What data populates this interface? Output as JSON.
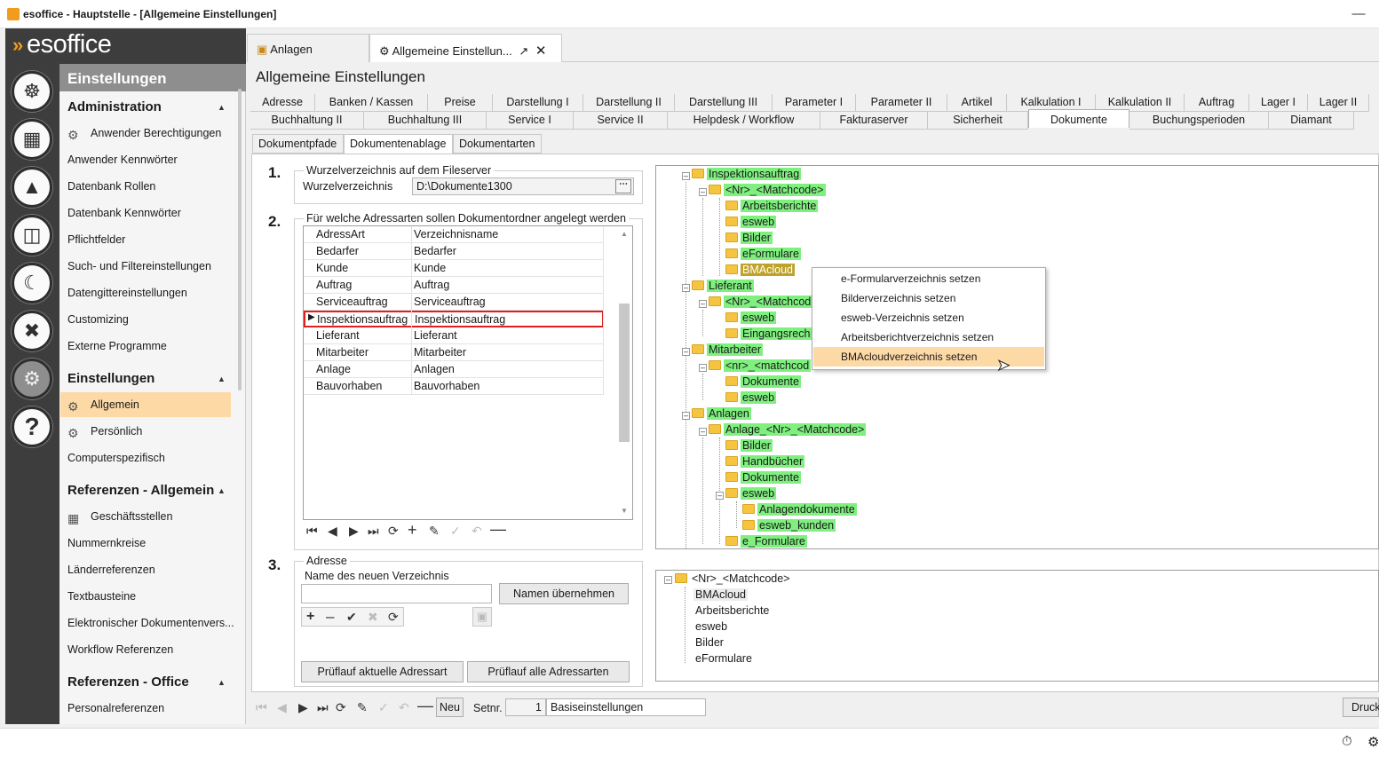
{
  "window": {
    "title": "esoffice - Hauptstelle - [Allgemeine Einstellungen]",
    "min_icon": "minimize-icon",
    "max_icon": "maximize-icon",
    "close_icon": "close-icon"
  },
  "brand": {
    "logo_text": "esoffice",
    "accent": "#f29b1d"
  },
  "doc_tabs": [
    {
      "label": "Anlagen",
      "icon": "factory-icon"
    },
    {
      "label": "Allgemeine Einstellun...",
      "icon": "gear-icon",
      "active": true
    }
  ],
  "sidebar": {
    "header": "Einstellungen",
    "groups": [
      {
        "title": "Administration",
        "items": [
          "Anwender Berechtigungen",
          "Anwender Kennwörter",
          "Datenbank Rollen",
          "Datenbank Kennwörter",
          "Pflichtfelder",
          "Such- und Filtereinstellungen",
          "Datengittereinstellungen",
          "Customizing",
          "Externe Programme"
        ]
      },
      {
        "title": "Einstellungen",
        "items": [
          "Allgemein",
          "Persönlich",
          "Computerspezifisch"
        ]
      },
      {
        "title": "Referenzen - Allgemein",
        "items": [
          "Geschäftsstellen",
          "Nummernkreise",
          "Länderreferenzen",
          "Textbausteine",
          "Elektronischer Dokumentenvers...",
          "Workflow Referenzen"
        ]
      },
      {
        "title": "Referenzen - Office",
        "items": [
          "Personalreferenzen"
        ]
      }
    ]
  },
  "page_title": "Allgemeine Einstellungen",
  "tabs_row1": [
    "Adresse",
    "Banken / Kassen",
    "Preise",
    "Darstellung I",
    "Darstellung II",
    "Darstellung III",
    "Parameter I",
    "Parameter II",
    "Artikel",
    "Kalkulation I",
    "Kalkulation II",
    "Auftrag",
    "Lager I",
    "Lager II"
  ],
  "tabs_row2": [
    "Buchhaltung II",
    "Buchhaltung III",
    "Service I",
    "Service II",
    "Helpdesk / Workflow",
    "Fakturaserver",
    "Sicherheit",
    "Dokumente",
    "Buchungsperioden",
    "Diamant"
  ],
  "active_tab": "Dokumente",
  "subtabs": [
    "Dokumentpfade",
    "Dokumentenablage",
    "Dokumentarten"
  ],
  "active_subtab": "Dokumentenablage",
  "step1": {
    "num": "1.",
    "legend": "Wurzelverzeichnis auf dem Fileserver",
    "label": "Wurzelverzeichnis",
    "value": "D:\\Dokumente1300",
    "browse": "..."
  },
  "step2": {
    "num": "2.",
    "legend": "Für welche Adressarten sollen Dokumentordner angelegt werden",
    "columns": [
      "AdressArt",
      "Verzeichnisname"
    ],
    "rows": [
      [
        "Bedarfer",
        "Bedarfer"
      ],
      [
        "Kunde",
        "Kunde"
      ],
      [
        "Auftrag",
        "Auftrag"
      ],
      [
        "Serviceauftrag",
        "Serviceauftrag"
      ],
      [
        "Inspektionsauftrag",
        "Inspektionsauftrag"
      ],
      [
        "Lieferant",
        "Lieferant"
      ],
      [
        "Mitarbeiter",
        "Mitarbeiter"
      ],
      [
        "Anlage",
        "Anlagen"
      ],
      [
        "Bauvorhaben",
        "Bauvorhaben"
      ]
    ],
    "selected_row": "Inspektionsauftrag"
  },
  "step3": {
    "num": "3.",
    "legend": "Adresse",
    "label": "Name des neuen Verzeichnis",
    "value": "",
    "accept_btn": "Namen übernehmen",
    "check_current_btn": "Prüflauf aktuelle Adressart",
    "check_all_btn": "Prüflauf alle Adressarten"
  },
  "tree": {
    "nodes": [
      "Inspektionsauftrag",
      "<Nr>_<Matchcode>",
      "Arbeitsberichte",
      "esweb",
      "Bilder",
      "eFormulare",
      "BMAcloud",
      "Lieferant",
      "<Nr>_<Matchcod",
      "esweb",
      "Eingangsrech",
      "Mitarbeiter",
      "<nr>_<matchcod",
      "Dokumente",
      "esweb",
      "Anlagen",
      "Anlage_<Nr>_<Matchcode>",
      "Bilder",
      "Handbücher",
      "Dokumente",
      "esweb",
      "Anlagendokumente",
      "esweb_kunden",
      "e_Formulare"
    ]
  },
  "context_menu": [
    "e-Formularverzeichnis setzen",
    "Bilderverzeichnis setzen",
    "esweb-Verzeichnis setzen",
    "Arbeitsberichtverzeichnis setzen",
    "BMAcloudverzeichnis setzen"
  ],
  "context_selected": "BMAcloudverzeichnis setzen",
  "tree2": {
    "root": "<Nr>_<Matchcode>",
    "children": [
      "BMAcloud",
      "Arbeitsberichte",
      "esweb",
      "Bilder",
      "eFormulare"
    ]
  },
  "bottom": {
    "new_btn": "Neu",
    "setnr_label": "Setnr.",
    "setnr_value": "1",
    "set_name": "Basiseinstellungen",
    "print_btn": "Druck"
  }
}
